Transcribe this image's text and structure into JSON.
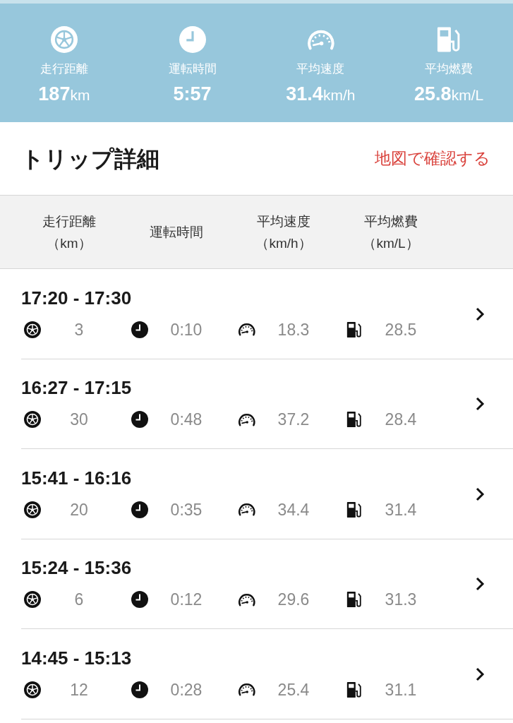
{
  "summary": [
    {
      "kind": "wheel",
      "label": "走行距離",
      "value": "187",
      "unit": "km"
    },
    {
      "kind": "clock",
      "label": "運転時間",
      "value": "5:57"
    },
    {
      "kind": "speed",
      "label": "平均速度",
      "value": "31.4",
      "unit": "km/h"
    },
    {
      "kind": "fuel",
      "label": "平均燃費",
      "value": "25.8",
      "unit": "km/L"
    }
  ],
  "section": {
    "title": "トリップ詳細",
    "link": "地図で確認する"
  },
  "columns": [
    {
      "label": "走行距離",
      "unit": "（km）"
    },
    {
      "label": "運転時間"
    },
    {
      "label": "平均速度",
      "unit": "（km/h）"
    },
    {
      "label": "平均燃費",
      "unit": "（km/L）"
    }
  ],
  "trips": [
    {
      "time": "17:20 - 17:30",
      "cells": [
        {
          "kind": "wheel",
          "value": "3"
        },
        {
          "kind": "clock",
          "value": "0:10"
        },
        {
          "kind": "speed",
          "value": "18.3"
        },
        {
          "kind": "fuel",
          "value": "28.5"
        }
      ]
    },
    {
      "time": "16:27 - 17:15",
      "cells": [
        {
          "kind": "wheel",
          "value": "30"
        },
        {
          "kind": "clock",
          "value": "0:48"
        },
        {
          "kind": "speed",
          "value": "37.2"
        },
        {
          "kind": "fuel",
          "value": "28.4"
        }
      ]
    },
    {
      "time": "15:41 - 16:16",
      "cells": [
        {
          "kind": "wheel",
          "value": "20"
        },
        {
          "kind": "clock",
          "value": "0:35"
        },
        {
          "kind": "speed",
          "value": "34.4"
        },
        {
          "kind": "fuel",
          "value": "31.4"
        }
      ]
    },
    {
      "time": "15:24 - 15:36",
      "cells": [
        {
          "kind": "wheel",
          "value": "6"
        },
        {
          "kind": "clock",
          "value": "0:12"
        },
        {
          "kind": "speed",
          "value": "29.6"
        },
        {
          "kind": "fuel",
          "value": "31.3"
        }
      ]
    },
    {
      "time": "14:45 - 15:13",
      "cells": [
        {
          "kind": "wheel",
          "value": "12"
        },
        {
          "kind": "clock",
          "value": "0:28"
        },
        {
          "kind": "speed",
          "value": "25.4"
        },
        {
          "kind": "fuel",
          "value": "31.1"
        }
      ]
    }
  ]
}
